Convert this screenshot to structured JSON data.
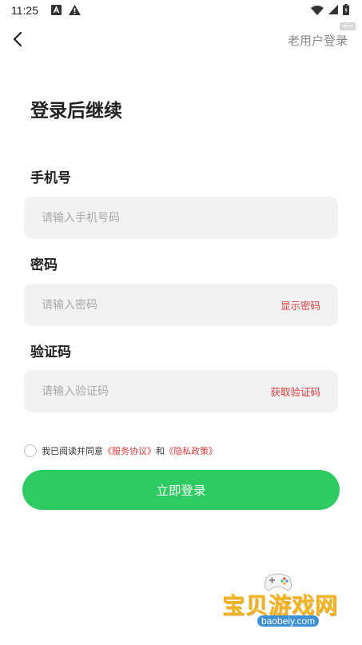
{
  "status_bar": {
    "time": "11:25"
  },
  "nav": {
    "old_user_login": "老用户登录",
    "badge": "4fm"
  },
  "page": {
    "title": "登录后继续"
  },
  "phone": {
    "label": "手机号",
    "placeholder": "请输入手机号码"
  },
  "password": {
    "label": "密码",
    "placeholder": "请输入密码",
    "action": "显示密码"
  },
  "code": {
    "label": "验证码",
    "placeholder": "请输入验证码",
    "action": "获取验证码"
  },
  "agreement": {
    "prefix": "我已阅读并同意",
    "service": "《服务协议》",
    "and": "和",
    "privacy": "《隐私政策》"
  },
  "login_button": {
    "label": "立即登录"
  },
  "watermark": {
    "title": "宝贝游戏网",
    "url": "baobeiy.com"
  },
  "colors": {
    "accent_green": "#2ecb62",
    "link_red": "#e4393c",
    "field_bg": "#f2f2f2",
    "placeholder": "#a9a9a9"
  },
  "icons": [
    "notification-a-icon",
    "warning-icon",
    "wifi-icon",
    "signal-icon",
    "battery-icon",
    "back-chevron-icon"
  ]
}
